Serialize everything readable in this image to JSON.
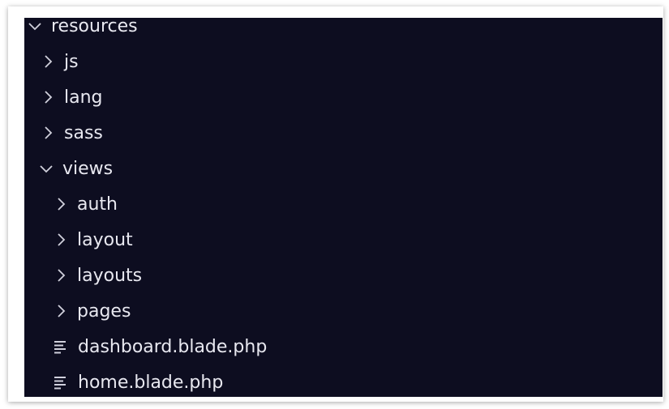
{
  "tree": {
    "root": {
      "label": "resources",
      "expanded": true,
      "icon": "chevron-down-icon"
    },
    "items": [
      {
        "label": "js",
        "type": "folder",
        "expanded": false,
        "icon": "chevron-right-icon"
      },
      {
        "label": "lang",
        "type": "folder",
        "expanded": false,
        "icon": "chevron-right-icon"
      },
      {
        "label": "sass",
        "type": "folder",
        "expanded": false,
        "icon": "chevron-right-icon"
      },
      {
        "label": "views",
        "type": "folder",
        "expanded": true,
        "icon": "chevron-down-icon",
        "children": [
          {
            "label": "auth",
            "type": "folder",
            "expanded": false,
            "icon": "chevron-right-icon"
          },
          {
            "label": "layout",
            "type": "folder",
            "expanded": false,
            "icon": "chevron-right-icon"
          },
          {
            "label": "layouts",
            "type": "folder",
            "expanded": false,
            "icon": "chevron-right-icon"
          },
          {
            "label": "pages",
            "type": "folder",
            "expanded": false,
            "icon": "chevron-right-icon"
          },
          {
            "label": "dashboard.blade.php",
            "type": "file",
            "icon": "file-lines-icon"
          },
          {
            "label": "home.blade.php",
            "type": "file",
            "icon": "file-lines-icon"
          }
        ]
      }
    ]
  },
  "colors": {
    "background": "#0d0d20",
    "text": "#e8e8f0"
  }
}
